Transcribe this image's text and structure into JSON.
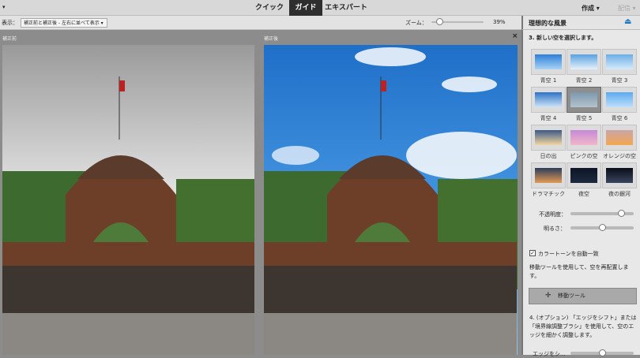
{
  "topbar": {
    "tabs": [
      {
        "label": "クイック"
      },
      {
        "label": "ガイド",
        "active": true
      },
      {
        "label": "エキスパート"
      }
    ],
    "create": "作成 ▾",
    "share": "配信 ▾"
  },
  "toolbar": {
    "view_label": "表示：",
    "view_value": "補正前と補正後 - 左右に並べて表示",
    "zoom_label": "ズーム：",
    "zoom_value": "39%",
    "zoom_fraction": 0.15
  },
  "canvas": {
    "before_label": "補正前",
    "after_label": "補正後",
    "close": "×"
  },
  "panel": {
    "title": "理想的な風景",
    "step3": "3. 新しい空を選択します。",
    "skies": [
      {
        "label": "青空 1",
        "colors": [
          "#2f7fd8",
          "#a9d3f5"
        ]
      },
      {
        "label": "青空 2",
        "colors": [
          "#5aa2e0",
          "#e6f1fb"
        ]
      },
      {
        "label": "青空 3",
        "colors": [
          "#6aaee6",
          "#d6ebfb"
        ]
      },
      {
        "label": "青空 4",
        "colors": [
          "#2d73c6",
          "#cfe4f7"
        ]
      },
      {
        "label": "青空 5",
        "colors": [
          "#7b98ad",
          "#b5c3cc"
        ],
        "selected": true
      },
      {
        "label": "青空 6",
        "colors": [
          "#5aaaf0",
          "#bfe0fb"
        ]
      },
      {
        "label": "日の出",
        "colors": [
          "#3d5a87",
          "#f3d6a0"
        ]
      },
      {
        "label": "ピンクの空",
        "colors": [
          "#c58ad6",
          "#f2b7c8"
        ]
      },
      {
        "label": "オレンジの空",
        "colors": [
          "#c9a5a8",
          "#f5a64e"
        ]
      },
      {
        "label": "ドラマチック",
        "colors": [
          "#2c3d5a",
          "#e39a55"
        ]
      },
      {
        "label": "夜空",
        "colors": [
          "#0d1526",
          "#1e2a40"
        ]
      },
      {
        "label": "夜の銀河",
        "colors": [
          "#0a0d18",
          "#38475e"
        ]
      }
    ],
    "opacity_label": "不透明度：",
    "opacity_value": 0.8,
    "brightness_label": "明るさ：",
    "brightness_value": 0.5,
    "auto_color_label": "カラートーンを自動一致",
    "auto_color_checked": true,
    "move_text": "移動ツールを使用して、空を再配置します。",
    "move_button": "移動ツール",
    "step4": "4. (オプション) 「エッジをシフト」または「境界線調整ブラシ」を使用して、空のエッジを細かく調整します。",
    "edge_label": "エッジをシ..."
  },
  "colors": {
    "accent": "#1a78c2",
    "tab_active": "#2e2e2e"
  }
}
